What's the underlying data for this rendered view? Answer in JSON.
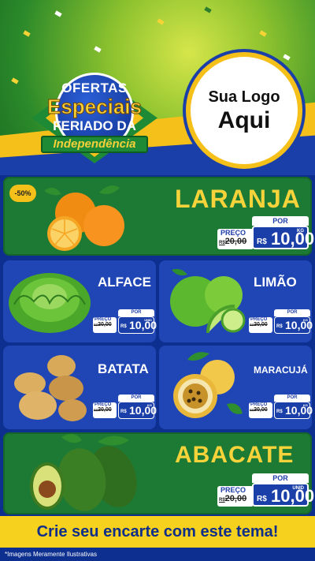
{
  "header": {
    "badge": {
      "line1": "OFERTAS",
      "line2": "Especiais",
      "line3": "FERIADO DA",
      "ribbon": "Independência"
    },
    "logo": {
      "line1": "Sua Logo",
      "line2": "Aqui"
    }
  },
  "products": [
    {
      "name": "LARANJA",
      "tag": "-50%",
      "preco_label": "PREÇO",
      "old_price": "20,00",
      "old_prefix": "R$",
      "por_label": "POR",
      "currency": "R$",
      "price": "10,00",
      "unit": "KG"
    },
    {
      "name": "ALFACE",
      "preco_label": "PREÇO",
      "old_price": "20,00",
      "old_prefix": "R$",
      "por_label": "POR",
      "currency": "R$",
      "price": "10,00",
      "unit": "UNID"
    },
    {
      "name": "LIMÃO",
      "preco_label": "PREÇO",
      "old_price": "20,00",
      "old_prefix": "R$",
      "por_label": "POR",
      "currency": "R$",
      "price": "10,00",
      "unit": "KG"
    },
    {
      "name": "BATATA",
      "preco_label": "PREÇO",
      "old_price": "20,00",
      "old_prefix": "R$",
      "por_label": "POR",
      "currency": "R$",
      "price": "10,00",
      "unit": "KG"
    },
    {
      "name": "MARACUJÁ",
      "preco_label": "PREÇO",
      "old_price": "20,00",
      "old_prefix": "R$",
      "por_label": "POR",
      "currency": "R$",
      "price": "10,00",
      "unit": "KG"
    },
    {
      "name": "ABACATE",
      "preco_label": "PREÇO",
      "old_price": "20,00",
      "old_prefix": "R$",
      "por_label": "POR",
      "currency": "R$",
      "price": "10,00",
      "unit": "UNID"
    }
  ],
  "footer": {
    "cta": "Crie seu encarte com este tema!",
    "note": "*Imagens Meramente Ilustrativas"
  },
  "colors": {
    "panel_green": "#1d7a34",
    "panel_blue": "#1f46b4",
    "title_yellow": "#f6d33a",
    "price_blue": "#1b3fa8",
    "footer_yellow": "#f6d11e"
  }
}
